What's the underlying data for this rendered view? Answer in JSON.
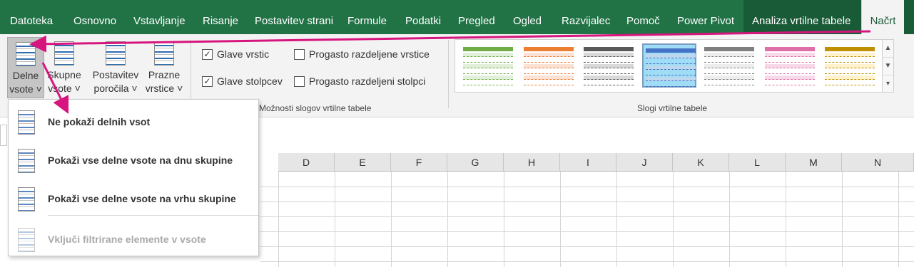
{
  "menu_tabs": [
    "Datoteka",
    "Osnovno",
    "Vstavljanje",
    "Risanje",
    "Postavitev strani",
    "Formule",
    "Podatki",
    "Pregled",
    "Ogled",
    "Razvijalec",
    "Pomoč",
    "Power Pivot",
    "Analiza vrtilne tabele",
    "Načrt"
  ],
  "active_tab": "Načrt",
  "ribbon": {
    "layout_buttons": [
      {
        "line1": "Delne",
        "line2": "vsote ˅"
      },
      {
        "line1": "Skupne",
        "line2": "vsote ˅"
      },
      {
        "line1": "Postavitev",
        "line2": "poročila ˅"
      },
      {
        "line1": "Prazne",
        "line2": "vrstice ˅"
      }
    ],
    "options": {
      "row_headers": {
        "label": "Glave vrstic",
        "checked": true
      },
      "col_headers": {
        "label": "Glave stolpcev",
        "checked": true
      },
      "banded_rows": {
        "label": "Progasto razdeljene vrstice",
        "checked": false
      },
      "banded_cols": {
        "label": "Progasto razdeljeni stolpci",
        "checked": false
      },
      "group_label": "Možnosti slogov vrtilne tabele"
    },
    "styles": {
      "group_label": "Slogi vrtilne tabele",
      "swatches": [
        {
          "accent": "#70ad47",
          "fill": "#e2efda",
          "bg": "#ffffff",
          "selected": false
        },
        {
          "accent": "#ed7d31",
          "fill": "#fbe2d5",
          "bg": "#ffffff",
          "selected": false
        },
        {
          "accent": "#595959",
          "fill": "#d9d9d9",
          "bg": "#ffffff",
          "selected": false
        },
        {
          "accent": "#4472c4",
          "fill": "#bdd7ee",
          "bg": "#9fdcf6",
          "selected": true
        },
        {
          "accent": "#7f7f7f",
          "fill": "#ededed",
          "bg": "#ffffff",
          "selected": false
        },
        {
          "accent": "#e06fa9",
          "fill": "#f8d9ea",
          "bg": "#ffffff",
          "selected": false
        },
        {
          "accent": "#bf9000",
          "fill": "#fff2cc",
          "bg": "#ffffff",
          "selected": false
        }
      ],
      "scroll_up": "▲",
      "scroll_down": "▼",
      "scroll_more": "▾"
    }
  },
  "grid": {
    "columns": [
      "D",
      "E",
      "F",
      "G",
      "H",
      "I",
      "J",
      "K",
      "L",
      "M",
      "N"
    ]
  },
  "dropdown": {
    "items": [
      {
        "label": "Ne pokaži delnih vsot",
        "disabled": false
      },
      {
        "label": "Pokaži vse delne vsote na dnu skupine",
        "disabled": false
      },
      {
        "label": "Pokaži vse delne vsote na vrhu skupine",
        "disabled": false
      },
      {
        "label": "Vključi filtrirane elemente v vsote",
        "disabled": true
      }
    ]
  },
  "colors": {
    "menubar": "#217346",
    "context_tabs": "#195a37",
    "arrow": "#d6157e"
  }
}
